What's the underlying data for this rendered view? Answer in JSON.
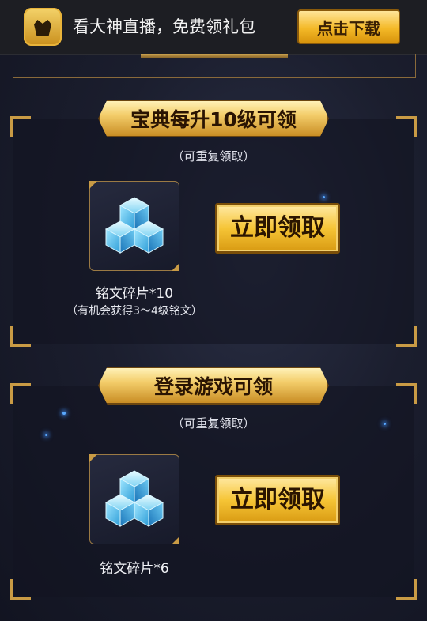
{
  "banner": {
    "text": "看大神直播，免费领礼包",
    "download_label": "点击下载",
    "logo_icon": "crown-icon"
  },
  "sections": [
    {
      "title": "宝典每升10级可领",
      "subtitle": "（可重复领取）",
      "item_name": "铭文碎片*10",
      "item_note": "（有机会获得3～4级铭文）",
      "item_icon": "crystal-cubes-icon",
      "claim_label": "立即领取"
    },
    {
      "title": "登录游戏可领",
      "subtitle": "（可重复领取）",
      "item_name": "铭文碎片*6",
      "item_note": "",
      "item_icon": "crystal-cubes-icon",
      "claim_label": "立即领取"
    }
  ],
  "colors": {
    "gold": "#f3c33a",
    "frame": "#7e6237",
    "background": "#1b1e2e"
  }
}
